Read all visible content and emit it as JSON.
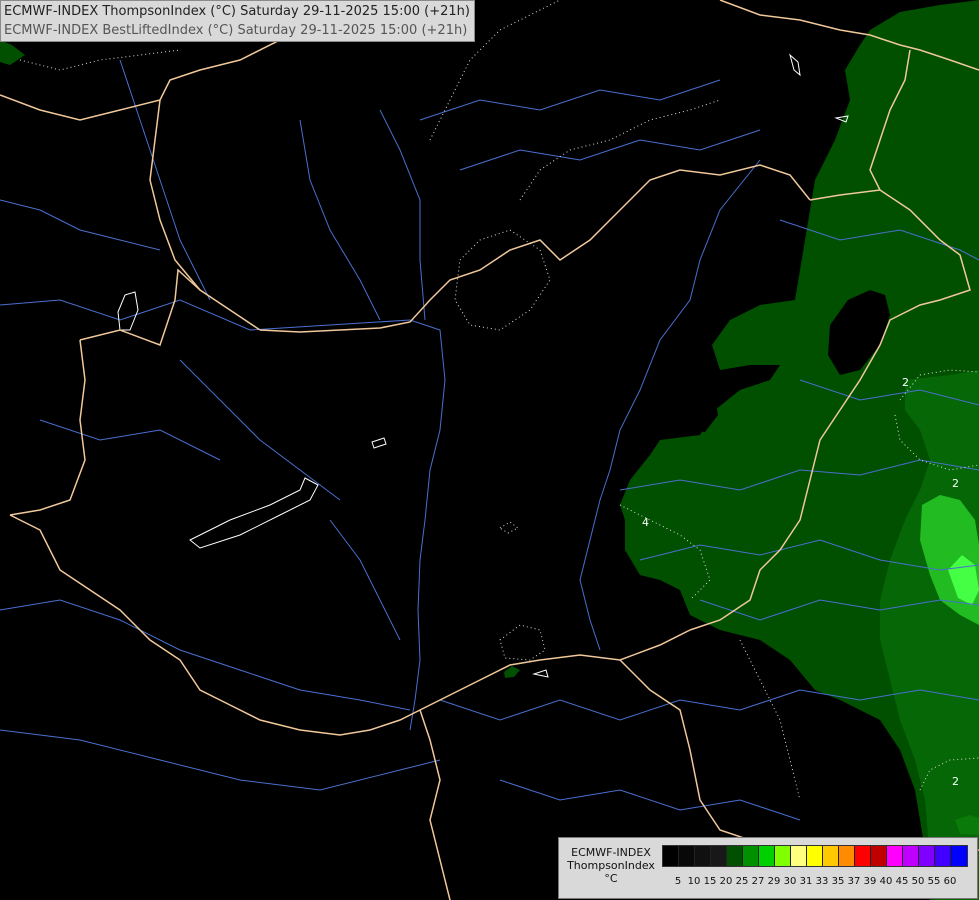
{
  "header": {
    "line1": "ECMWF-INDEX ThompsonIndex (°C) Saturday 29-11-2025 15:00 (+21h)",
    "line2": "ECMWF-INDEX BestLiftedIndex (°C) Saturday 29-11-2025 15:00 (+21h)"
  },
  "legend": {
    "model": "ECMWF-INDEX",
    "variable": "ThompsonIndex",
    "unit": "°C",
    "colors": [
      "#000000",
      "#080808",
      "#101010",
      "#181818",
      "#005000",
      "#009000",
      "#00d000",
      "#80ff00",
      "#ffff80",
      "#ffff00",
      "#ffc800",
      "#ff8c00",
      "#ff0000",
      "#c00000",
      "#ff00ff",
      "#c000ff",
      "#8000ff",
      "#4000ff",
      "#0000ff"
    ],
    "ticks": [
      "5",
      "10",
      "15",
      "20",
      "25",
      "27",
      "29",
      "30",
      "31",
      "33",
      "35",
      "37",
      "39",
      "40",
      "45",
      "50",
      "55",
      "60"
    ]
  },
  "contour_labels": [
    "4",
    "2",
    "2",
    "2"
  ],
  "colors": {
    "background": "#000000",
    "shade_dark": "#005000",
    "shade_mid": "#0a7a0a",
    "shade_light": "#22bb22",
    "shade_bright": "#44ff44",
    "border_line": "#f0c89a",
    "river": "#4a6fd0"
  }
}
